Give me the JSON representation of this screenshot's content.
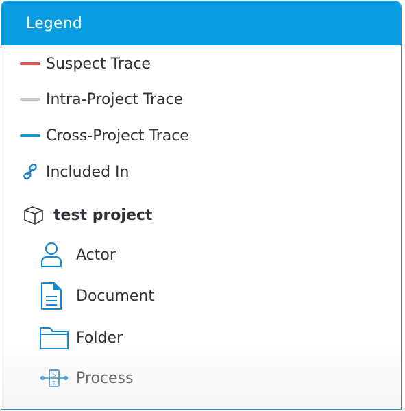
{
  "legend": {
    "title": "Legend",
    "traces": [
      {
        "label": "Suspect Trace",
        "color": "#e05050"
      },
      {
        "label": "Intra-Project Trace",
        "color": "#c8c8c8"
      },
      {
        "label": "Cross-Project Trace",
        "color": "#1a96d4"
      }
    ],
    "included_in": {
      "label": "Included In",
      "icon": "link-icon"
    },
    "project": {
      "label": "test project",
      "icon": "cube-icon"
    },
    "types": [
      {
        "label": "Actor",
        "icon": "actor-icon"
      },
      {
        "label": "Document",
        "icon": "document-icon"
      },
      {
        "label": "Folder",
        "icon": "folder-icon"
      },
      {
        "label": "Process",
        "icon": "process-icon"
      }
    ],
    "accent_color": "#0a9ce0"
  }
}
